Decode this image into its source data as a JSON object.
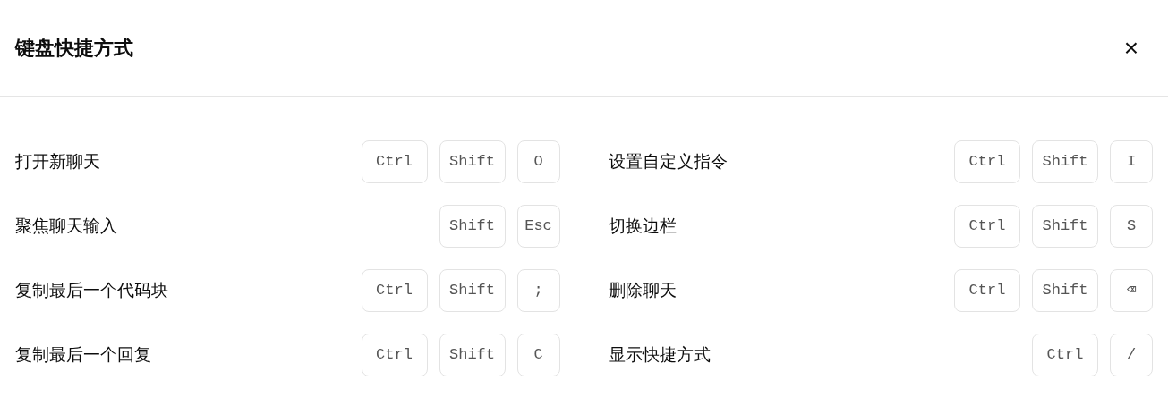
{
  "dialog": {
    "title": "键盘快捷方式",
    "close": "×"
  },
  "shortcuts": [
    {
      "label": "打开新聊天",
      "keys": [
        "Ctrl",
        "Shift",
        "O"
      ]
    },
    {
      "label": "设置自定义指令",
      "keys": [
        "Ctrl",
        "Shift",
        "I"
      ]
    },
    {
      "label": "聚焦聊天输入",
      "keys": [
        "Shift",
        "Esc"
      ]
    },
    {
      "label": "切换边栏",
      "keys": [
        "Ctrl",
        "Shift",
        "S"
      ]
    },
    {
      "label": "复制最后一个代码块",
      "keys": [
        "Ctrl",
        "Shift",
        ";"
      ]
    },
    {
      "label": "删除聊天",
      "keys": [
        "Ctrl",
        "Shift",
        "⌫"
      ]
    },
    {
      "label": "复制最后一个回复",
      "keys": [
        "Ctrl",
        "Shift",
        "C"
      ]
    },
    {
      "label": "显示快捷方式",
      "keys": [
        "Ctrl",
        "/"
      ]
    }
  ]
}
